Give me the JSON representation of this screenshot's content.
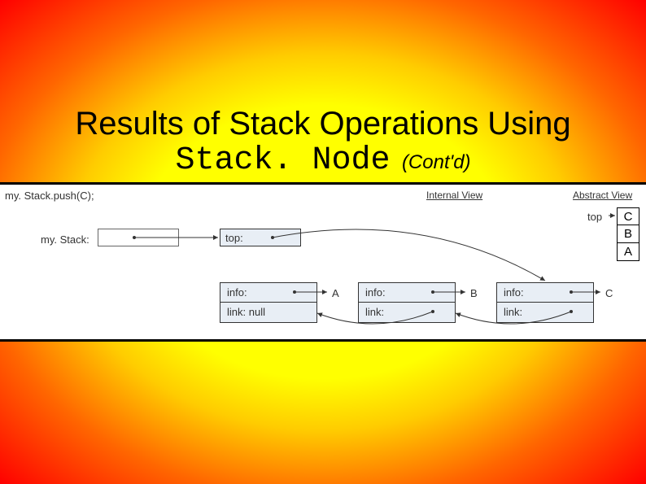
{
  "title": {
    "line1": "Results of Stack Operations Using",
    "line2": "Stack. Node",
    "contd": "(Cont'd)"
  },
  "diagram": {
    "push_call": "my. Stack.push(C);",
    "mystack_label": "my. Stack:",
    "internal_view": "Internal View",
    "abstract_view": "Abstract View",
    "top_box_label": "top:",
    "nodes": {
      "a": {
        "info": "info:",
        "link": "link: null",
        "value": "A"
      },
      "b": {
        "info": "info:",
        "link": "link:",
        "value": "B"
      },
      "c": {
        "info": "info:",
        "link": "link:",
        "value": "C"
      }
    },
    "abstract": {
      "top_label": "top",
      "cells": [
        "C",
        "B",
        "A"
      ]
    }
  }
}
